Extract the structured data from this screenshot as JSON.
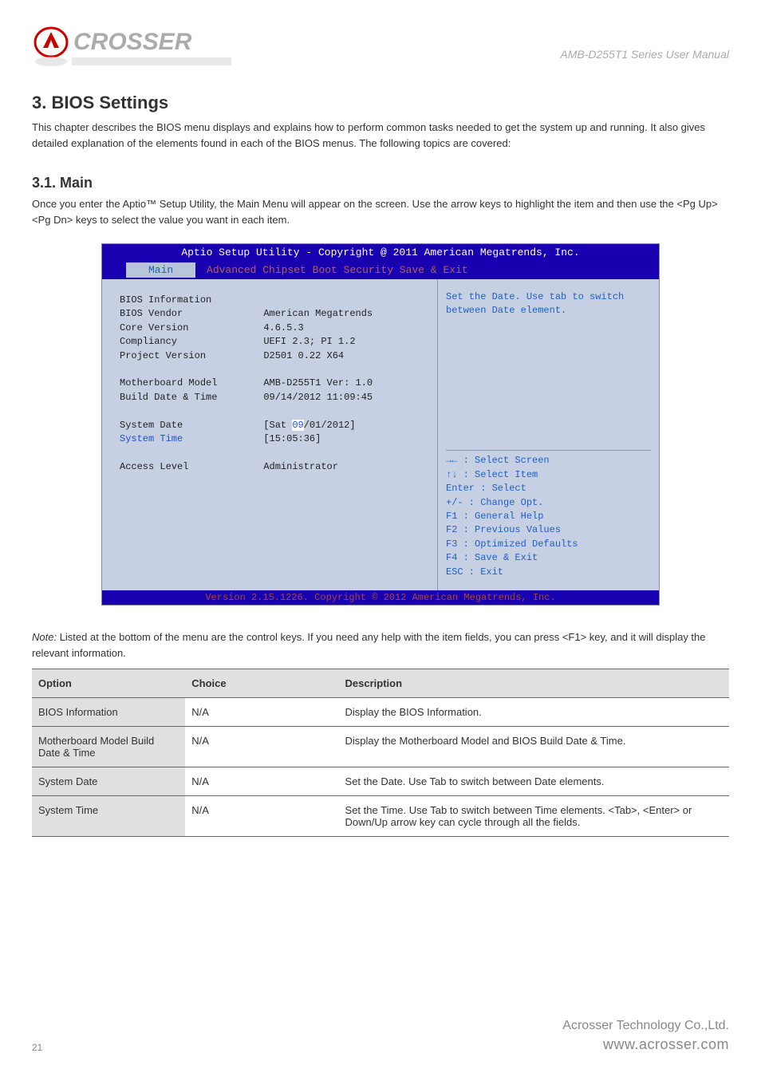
{
  "doc": {
    "header_title": "AMB-D255T1 Series User Manual"
  },
  "sections": {
    "num_title": "3. BIOS Settings",
    "intro": "This chapter describes the BIOS menu displays and explains how to perform common tasks needed to get the system up and running. It also gives detailed explanation of the elements found in each of the BIOS menus. The following topics are covered:",
    "sub31_title": "3.1. Main",
    "sub31_body": "Once you enter the Aptio™ Setup Utility, the Main Menu will appear on the screen. Use the arrow keys to highlight the item and then use the <Pg Up> <Pg Dn> keys to select the value you want in each item.",
    "note_label": "Note:",
    "note_text": " Listed at the bottom of the menu are the control keys. If you need any help with the item fields, you can press <F1> key, and it will display the relevant information.",
    "table": {
      "headers": [
        "Option",
        "Choice",
        "Description"
      ],
      "rows": [
        {
          "a": "BIOS Information",
          "b": "N/A",
          "c": "Display the BIOS Information."
        },
        {
          "a": "Motherboard Model Build Date & Time",
          "b": "N/A",
          "c": "Display the Motherboard Model and BIOS Build Date & Time."
        },
        {
          "a": "System Date",
          "b": "N/A",
          "c": "Set the Date. Use Tab to switch between Date elements."
        },
        {
          "a": "System Time",
          "b": "N/A",
          "c": "Set the Time. Use Tab to switch between Time elements. <Tab>, <Enter> or Down/Up arrow key can cycle through all the fields."
        }
      ]
    }
  },
  "bios": {
    "header": "Aptio Setup Utility - Copyright @ 2011 American Megatrends, Inc.",
    "tabs": {
      "active": "Main",
      "inactive": "Advanced  Chipset  Boot Security      Save & Exit"
    },
    "left": {
      "title": "BIOS Information",
      "rows": [
        {
          "label": "BIOS Vendor",
          "value": "American Megatrends"
        },
        {
          "label": "Core Version",
          "value": "4.6.5.3"
        },
        {
          "label": "Compliancy",
          "value": "UEFI 2.3; PI 1.2"
        },
        {
          "label": "Project Version",
          "value": "D2501 0.22 X64"
        }
      ],
      "mb_label": "Motherboard Model",
      "mb_value": "AMB-D255T1 Ver: 1.0",
      "build_label": "Build Date & Time",
      "build_value": "09/14/2012  11:09:45",
      "sysdate_label": "System Date",
      "sysdate_value_prefix": "[Sat ",
      "sysdate_value_hl": "09",
      "sysdate_value_suffix": "/01/2012]",
      "systime_label": "System Time",
      "systime_value": "[15:05:36]",
      "access_label": "Access Level",
      "access_value": "Administrator"
    },
    "right": {
      "help": "Set the Date. Use tab to switch between Date element.",
      "keys": [
        "→← : Select Screen",
        "↑↓ : Select Item",
        "Enter : Select",
        "+/- : Change Opt.",
        "F1 : General Help",
        "F2 : Previous Values",
        "F3 : Optimized Defaults",
        "F4 : Save & Exit",
        "ESC : Exit"
      ]
    },
    "footer": "Version 2.15.1226. Copyright © 2012 American Megatrends, Inc."
  },
  "footer": {
    "page": "21",
    "brand1": "Acrosser Technology Co.,Ltd.",
    "brand2": "www.acrosser.com"
  }
}
